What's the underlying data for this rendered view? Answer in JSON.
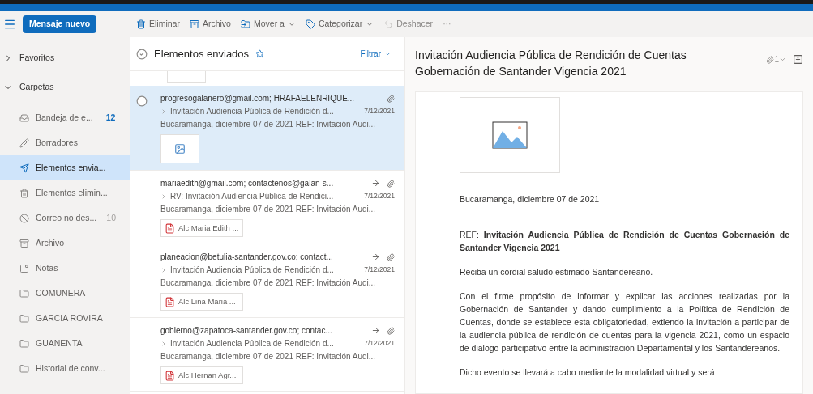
{
  "toolbar": {
    "new_message": "Mensaje nuevo",
    "actions": [
      {
        "label": "Eliminar",
        "kind": "trash",
        "disabled": false,
        "dropdown": false
      },
      {
        "label": "Archivo",
        "kind": "archive",
        "disabled": false,
        "dropdown": false
      },
      {
        "label": "Mover a",
        "kind": "move",
        "disabled": false,
        "dropdown": true
      },
      {
        "label": "Categorizar",
        "kind": "tag",
        "disabled": false,
        "dropdown": true
      },
      {
        "label": "Deshacer",
        "kind": "undo",
        "disabled": true,
        "dropdown": false
      }
    ],
    "more": "···"
  },
  "sidebar": {
    "sections": [
      {
        "label": "Favoritos",
        "expanded": false
      },
      {
        "label": "Carpetas",
        "expanded": true
      }
    ],
    "folders": [
      {
        "label": "Bandeja de e...",
        "kind": "inbox",
        "count": "12",
        "selected": false
      },
      {
        "label": "Borradores",
        "kind": "drafts",
        "selected": false
      },
      {
        "label": "Elementos envia...",
        "kind": "sent",
        "selected": true
      },
      {
        "label": "Elementos elimin...",
        "kind": "trash",
        "selected": false
      },
      {
        "label": "Correo no des...",
        "kind": "junk",
        "count": "10",
        "selected": false
      },
      {
        "label": "Archivo",
        "kind": "archive",
        "selected": false
      },
      {
        "label": "Notas",
        "kind": "notes",
        "selected": false
      },
      {
        "label": "COMUNERA",
        "kind": "folder",
        "selected": false
      },
      {
        "label": "GARCIA ROVIRA",
        "kind": "folder",
        "selected": false
      },
      {
        "label": "GUANENTA",
        "kind": "folder",
        "selected": false
      },
      {
        "label": "Historial de conv...",
        "kind": "folder",
        "selected": false
      }
    ]
  },
  "message_list": {
    "title": "Elementos enviados",
    "filter": "Filtrar",
    "messages": [
      {
        "selected": true,
        "recipients": "progresogalanero@gmail.com; HRAFAELENRIQUE...",
        "subject": "Invitación Audiencia Pública de Rendición d...",
        "date": "7/12/2021",
        "preview": "Bucaramanga, diciembre 07 de 2021 REF: Invitación Audi...",
        "forwarded": false,
        "attachment": {
          "kind": "image"
        }
      },
      {
        "selected": false,
        "recipients": "mariaedith@gmail.com; contactenos@galan-s...",
        "subject": "RV: Invitación Audiencia Pública de Rendici...",
        "date": "7/12/2021",
        "preview": "Bucaramanga, diciembre 07 de 2021 REF: Invitación Audi...",
        "forwarded": true,
        "attachment": {
          "kind": "pdf",
          "name": "Alc Maria Edith ..."
        }
      },
      {
        "selected": false,
        "recipients": "planeacion@betulia-santander.gov.co; contact...",
        "subject": "Invitación Audiencia Pública de Rendición d...",
        "date": "7/12/2021",
        "preview": "Bucaramanga, diciembre 07 de 2021 REF: Invitación Audi...",
        "forwarded": true,
        "attachment": {
          "kind": "pdf",
          "name": "Alc Lina Maria ..."
        }
      },
      {
        "selected": false,
        "recipients": "gobierno@zapatoca-santander.gov.co; contac...",
        "subject": "Invitación Audiencia Pública de Rendición d...",
        "date": "7/12/2021",
        "preview": "Bucaramanga, diciembre 07 de 2021 REF: Invitación Audi...",
        "forwarded": true,
        "attachment": {
          "kind": "pdf",
          "name": "Alc Hernan Agr..."
        }
      }
    ]
  },
  "reading_pane": {
    "subject": "Invitación Audiencia Pública de Rendición de Cuentas Gobernación de Santander Vigencia 2021",
    "attachment_count": "1",
    "body": [
      "Bucaramanga,  diciembre 07 de 2021",
      "REF: **Invitación Audiencia Pública de Rendición de Cuentas Gobernación de Santander Vigencia 2021**",
      "Reciba un cordial saludo estimado Santandereano.",
      "Con el firme propósito de informar y explicar las acciones realizadas por la Gobernación de Santander y dando cumplimiento a la Política de Rendición de Cuentas, donde se establece esta obligatoriedad, extiendo la invitación a participar de la audiencia pública de rendición de cuentas para la vigencia 2021, como un espacio de dialogo participativo entre la administración Departamental y los Santandereanos.",
      "Dicho evento se llevará a cabo mediante la modalidad virtual y será"
    ]
  }
}
